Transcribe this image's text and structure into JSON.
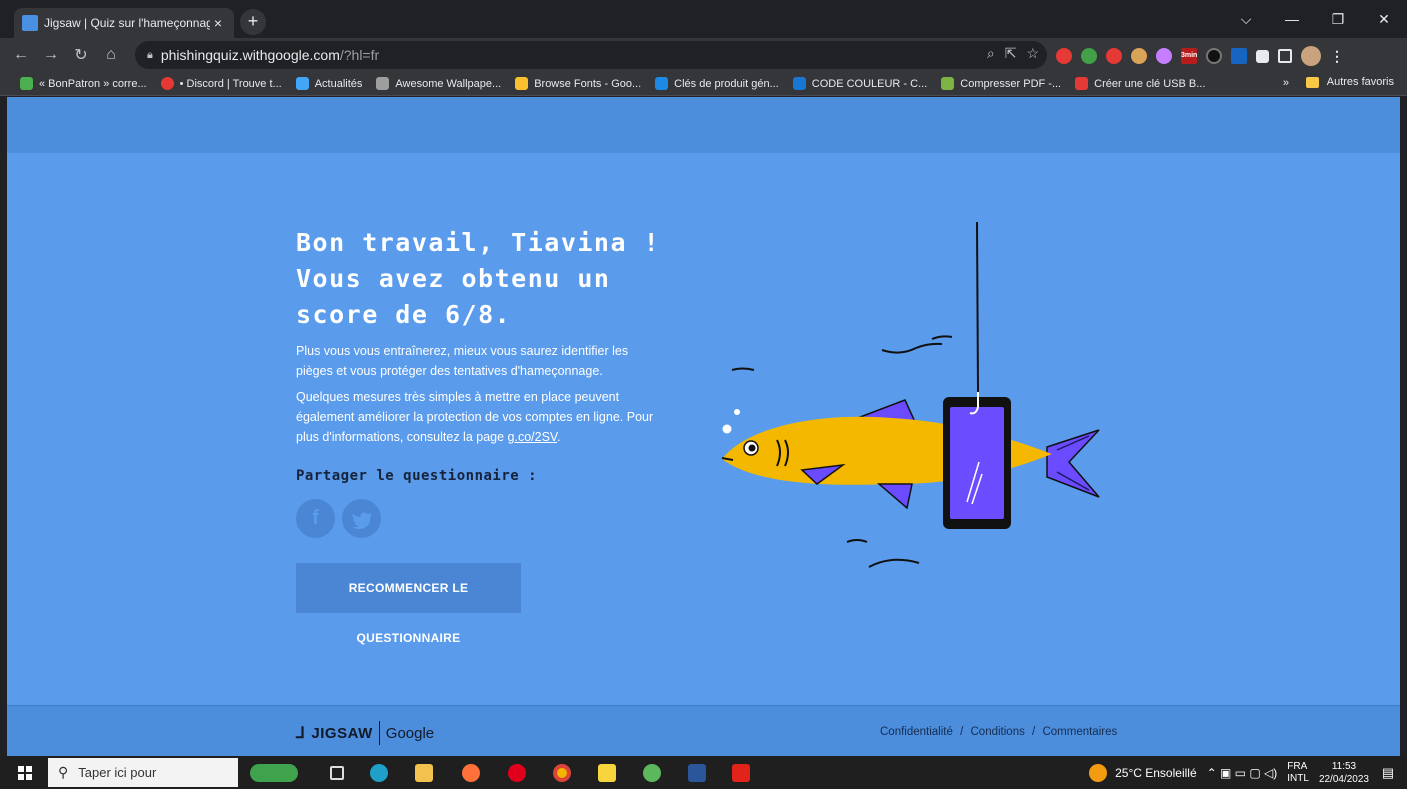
{
  "browser": {
    "tab_title": "Jigsaw | Quiz sur l'hameçonnage",
    "tab_close": "×",
    "new_tab": "+",
    "url_host": "phishingquiz.withgoogle.com",
    "url_path": "/?hl=fr",
    "bookmarks": [
      "« BonPatron » corre...",
      "• Discord | Trouve t...",
      "Actualités",
      "Awesome Wallpape...",
      "Browse Fonts - Goo...",
      "Clés de produit gén...",
      "CODE COULEUR - C...",
      "Compresser PDF -...",
      "Créer une clé USB B..."
    ],
    "bookmarks_more": "»",
    "other_bookmarks": "Autres favoris",
    "extension_badge": "3min"
  },
  "page": {
    "title": "Bon travail, Tiavina ! Vous avez obtenu un score de 6/8.",
    "paragraph1": "Plus vous vous entraînerez, mieux vous saurez identifier les pièges et vous protéger des tentatives d'hameçonnage.",
    "paragraph2_text": "Quelques mesures très simples à mettre en place peuvent également améliorer la protection de vos comptes en ligne. Pour plus d'informations, consultez la page ",
    "paragraph2_link": "g.co/2SV",
    "paragraph2_end": ".",
    "share_label": "Partager le questionnaire :",
    "restart_button": "RECOMMENCER LE QUESTIONNAIRE"
  },
  "footer": {
    "brand_jigsaw": "JIGSAW",
    "brand_google": "Google",
    "link_privacy": "Confidentialité",
    "link_terms": "Conditions",
    "link_feedback": "Commentaires",
    "separator": "/"
  },
  "taskbar": {
    "search_placeholder": "Taper ici pour",
    "weather": "25°C Ensoleillé",
    "lang_top": "FRA",
    "lang_bottom": "INTL",
    "time": "11:53",
    "date": "22/04/2023"
  },
  "colors": {
    "page_background": "#5a9bec",
    "header_band": "#4c8edc",
    "fish_body": "#f5b800",
    "fish_fins": "#6a4bff",
    "phone_screen": "#6b4cff"
  }
}
